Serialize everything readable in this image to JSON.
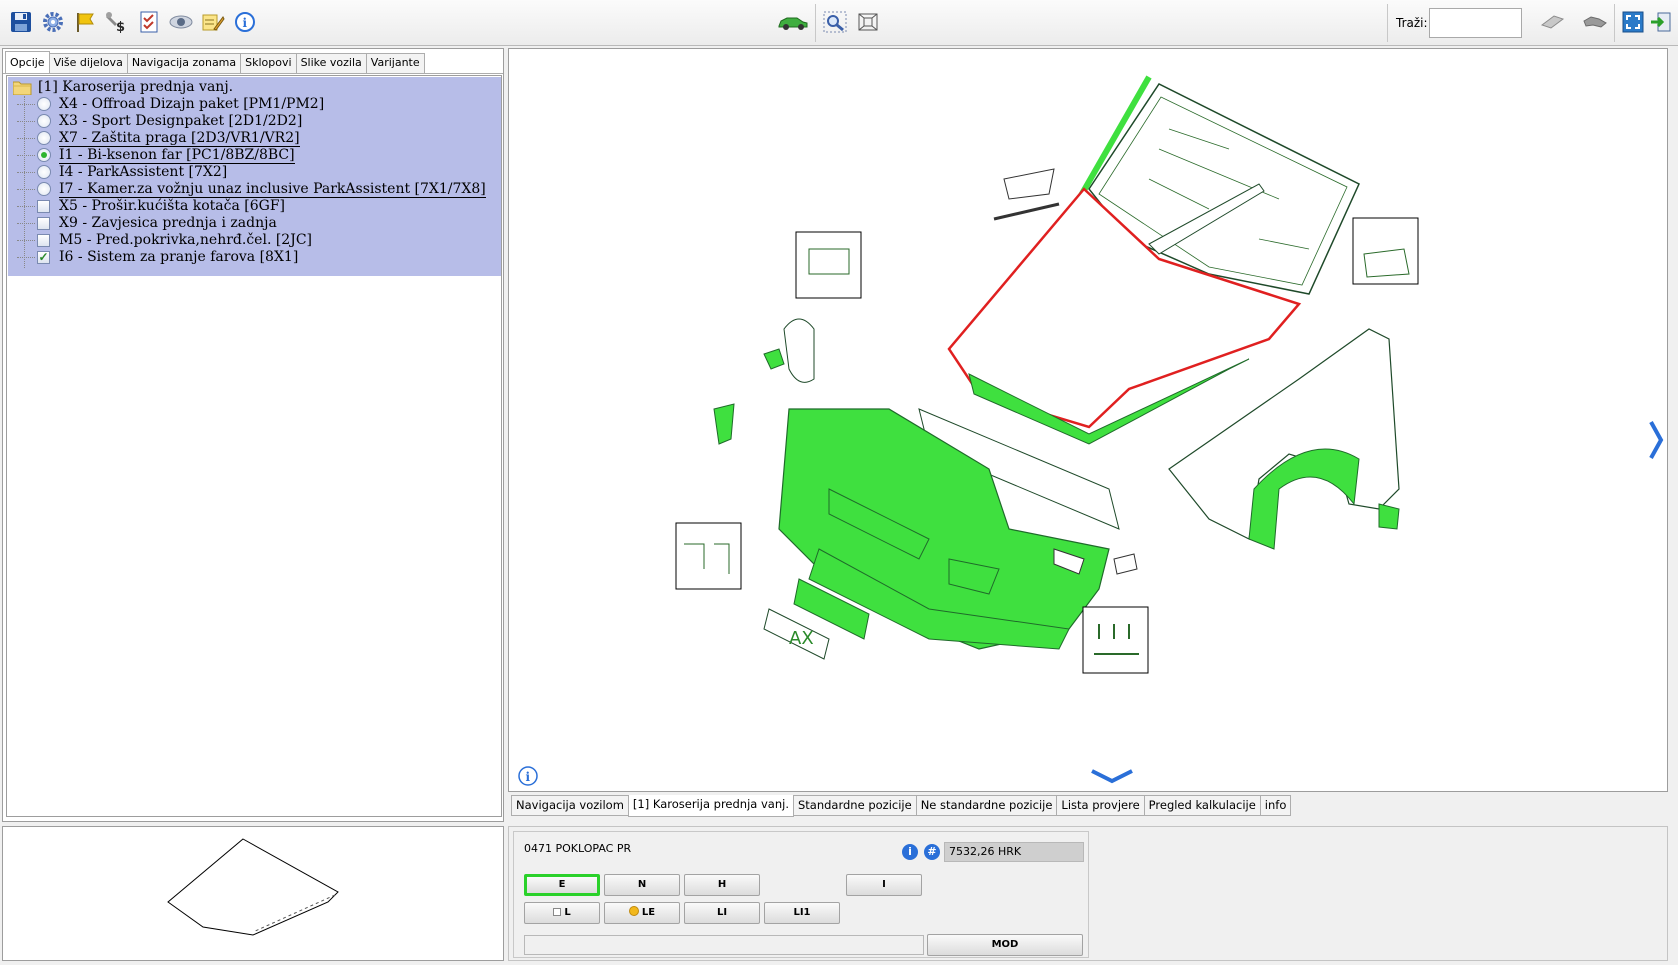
{
  "toolbar": {
    "icons": [
      "save-icon",
      "settings-gear-icon",
      "flag-icon",
      "tools-dollar-icon",
      "checklist-icon",
      "eye-icon",
      "notes-pencil-icon",
      "info-icon",
      "car-icon",
      "zoom-area-icon",
      "zoom-fit-icon",
      "eraser-icon",
      "link-icon",
      "fullscreen-icon",
      "exit-icon"
    ],
    "search_label": "Traži:",
    "search_value": ""
  },
  "left_tabs": [
    "Opcije",
    "Više dijelova",
    "Navigacija zonama",
    "Sklopovi",
    "Slike vozila",
    "Varijante"
  ],
  "tree": {
    "root": "[1] Karoserija prednja vanj.",
    "items": [
      {
        "type": "radio",
        "checked": false,
        "label": "X4 - Offroad Dizajn paket [PM1/PM2]",
        "underlined": false
      },
      {
        "type": "radio",
        "checked": false,
        "label": "X3 - Sport Designpaket [2D1/2D2]",
        "underlined": false
      },
      {
        "type": "radio",
        "checked": false,
        "label": "X7 - Zaštita praga [2D3/VR1/VR2]",
        "underlined": true
      },
      {
        "type": "radio",
        "checked": true,
        "label": "I1 - Bi-ksenon far [PC1/8BZ/8BC]",
        "underlined": true
      },
      {
        "type": "radio",
        "checked": false,
        "label": "I4 - ParkAssistent [7X2]",
        "underlined": false
      },
      {
        "type": "radio",
        "checked": false,
        "label": "I7 - Kamer.za vožnju unaz inclusive ParkAssistent [7X1/7X8]",
        "underlined": true
      },
      {
        "type": "check",
        "checked": false,
        "label": "X5 - Prošir.kućišta kotača [6GF]",
        "underlined": false
      },
      {
        "type": "check",
        "checked": false,
        "label": "X9 - Zavjesica prednja i zadnja",
        "underlined": false
      },
      {
        "type": "check",
        "checked": false,
        "label": "M5 - Pred.pokrivka,nehrđ.čel. [2JC]",
        "underlined": false
      },
      {
        "type": "check",
        "checked": true,
        "label": "I6 - Sistem za pranje farova [8X1]",
        "underlined": false
      }
    ]
  },
  "bottom_tabs": [
    "Navigacija vozilom",
    "[1] Karoserija prednja vanj.",
    "Standardne pozicije",
    "Ne standardne pozicije",
    "Lista provjere",
    "Pregled kalkulacije",
    "info"
  ],
  "drawing": {
    "plate_text": "AX",
    "colors": {
      "highlight": "#3fe03f",
      "selected_outline": "#e02020",
      "line": "#1f6b2a"
    }
  },
  "part": {
    "name": "0471 POKLOPAC PR",
    "info_icon": "i",
    "hash_icon": "#",
    "price": "7532,26 HRK",
    "buttons_row1": [
      "E",
      "N",
      "H",
      "I"
    ],
    "buttons_row2": [
      "L",
      "LE",
      "LI",
      "LI1"
    ],
    "mod_label": "MOD"
  }
}
